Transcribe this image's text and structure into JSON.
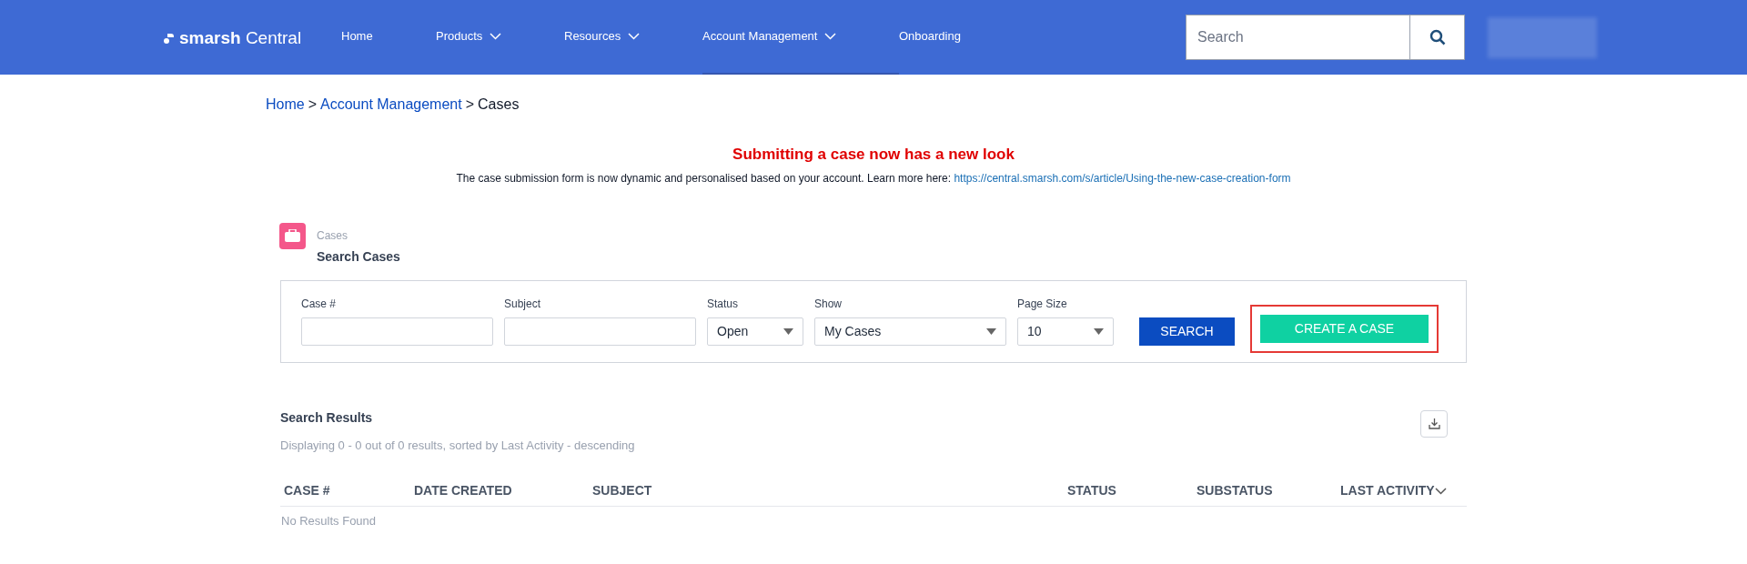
{
  "header": {
    "logo": {
      "mark": "smarsh",
      "product": "Central"
    },
    "nav": [
      {
        "label": "Home",
        "dropdown": false,
        "selected": false
      },
      {
        "label": "Products",
        "dropdown": true,
        "selected": false
      },
      {
        "label": "Resources",
        "dropdown": true,
        "selected": false
      },
      {
        "label": "Account Management",
        "dropdown": true,
        "selected": true
      },
      {
        "label": "Onboarding",
        "dropdown": false,
        "selected": false
      }
    ],
    "search": {
      "placeholder": "Search"
    }
  },
  "breadcrumb": [
    {
      "label": "Home",
      "kind": "link"
    },
    {
      "label": ">",
      "kind": "separator"
    },
    {
      "label": "Account Management",
      "kind": "link"
    },
    {
      "label": ">",
      "kind": "separator"
    },
    {
      "label": "Cases",
      "kind": "current"
    }
  ],
  "notice": {
    "title": "Submitting a case now has a new look",
    "text": "The case submission form is now dynamic and personalised based on your account. Learn more here:",
    "link": "https://central.smarsh.com/s/article/Using-the-new-case-creation-form"
  },
  "section": {
    "object": "Cases",
    "title": "Search Cases"
  },
  "filters": [
    {
      "label": "Case #",
      "kind": "text"
    },
    {
      "label": "Subject",
      "kind": "text"
    },
    {
      "label": "Status",
      "kind": "select",
      "value": "Open"
    },
    {
      "label": "Show",
      "kind": "select",
      "value": "My Cases"
    },
    {
      "label": "Page Size",
      "kind": "select",
      "value": "10"
    }
  ],
  "search_button": "SEARCH",
  "create_button": {
    "label": "CREATE A CASE",
    "highlighted": true
  },
  "results": {
    "title": "Search Results",
    "summary": "Displaying 0 - 0 out of 0 results, sorted by Last Activity - descending",
    "columns": [
      {
        "label": "CASE #",
        "sorted": false
      },
      {
        "label": "DATE CREATED",
        "sorted": false
      },
      {
        "label": "SUBJECT",
        "sorted": false
      },
      {
        "label": "STATUS",
        "sorted": false
      },
      {
        "label": "SUBSTATUS",
        "sorted": false
      },
      {
        "label": "LAST ACTIVITY",
        "sorted": true
      }
    ],
    "empty": "No Results Found"
  }
}
